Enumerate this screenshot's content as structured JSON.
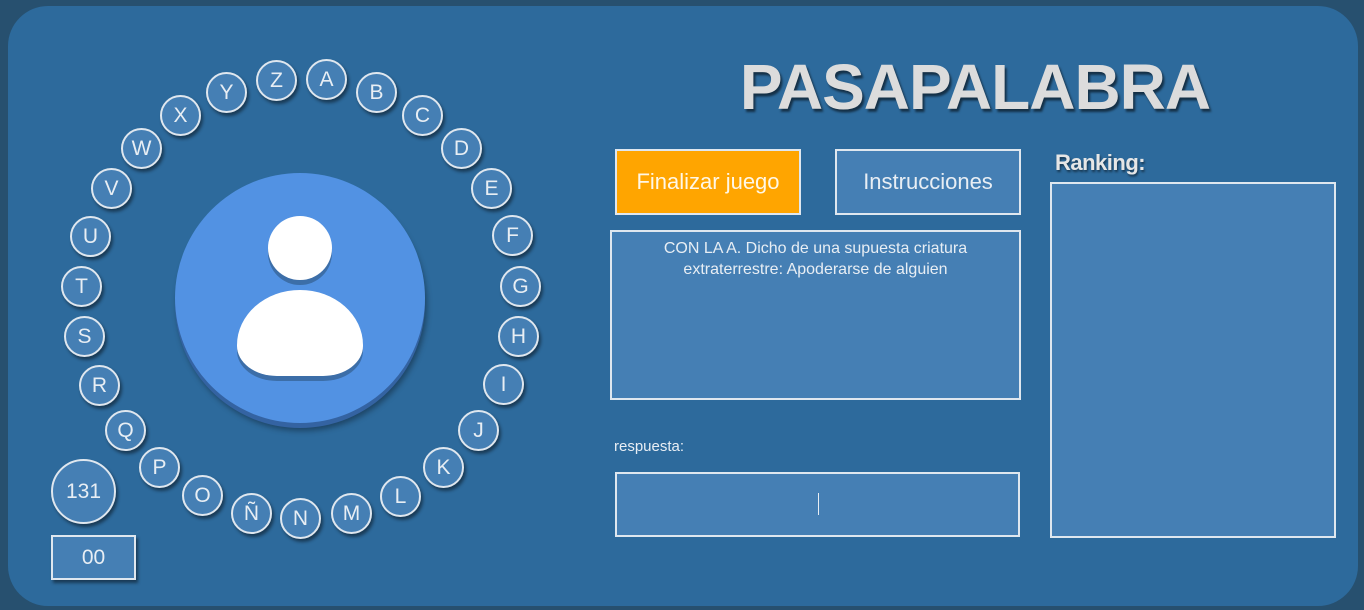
{
  "game": {
    "title": "PASAPALABRA",
    "timer": "131",
    "score": "00"
  },
  "letters": [
    "A",
    "B",
    "C",
    "D",
    "E",
    "F",
    "G",
    "H",
    "I",
    "J",
    "K",
    "L",
    "M",
    "N",
    "Ñ",
    "O",
    "P",
    "Q",
    "R",
    "S",
    "T",
    "U",
    "V",
    "W",
    "X",
    "Y",
    "Z"
  ],
  "buttons": {
    "finish_label": "Finalizar juego",
    "instructions_label": "Instrucciones"
  },
  "question": {
    "text": "CON LA A. Dicho de una supuesta criatura extraterrestre: Apoderarse de alguien"
  },
  "answer": {
    "label": "respuesta:",
    "value": ""
  },
  "ranking": {
    "label": "Ranking:",
    "entries": []
  },
  "colors": {
    "background": "#2d6a9c",
    "tile": "#457fb4",
    "accent": "#ffa500",
    "avatar": "#5292e3"
  },
  "icons": {
    "avatar": "user-avatar-icon"
  }
}
